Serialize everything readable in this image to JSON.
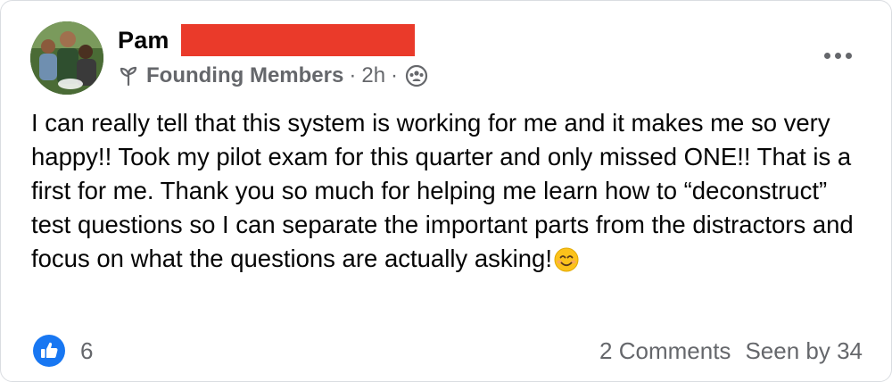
{
  "post": {
    "author": {
      "name": "Pam",
      "avatar_icon": "profile-photo-group"
    },
    "meta": {
      "group": "Founding Members",
      "separator": "·",
      "time": "2h",
      "privacy_icon": "group-privacy-icon"
    },
    "body": {
      "text": "I can really tell that this system is working for me and it makes me so very happy!! Took my pilot exam for this quarter and only missed ONE!! That is a first for me. Thank you so much for helping me learn how to “deconstruct” test questions so I can separate the important parts from the distractors and focus on what the questions are actually asking!",
      "emoji": "smiling-face-emoji"
    },
    "reactions": {
      "count": "6",
      "icon": "like-icon"
    },
    "comments_label": "2 Comments",
    "seen_label": "Seen by 34",
    "colors": {
      "like_blue": "#1877f2",
      "secondary_text": "#65676b",
      "redaction": "#ea3a2a"
    }
  }
}
